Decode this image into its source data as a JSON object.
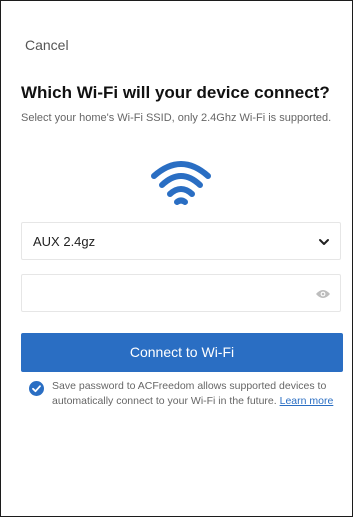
{
  "header": {
    "cancel_label": "Cancel"
  },
  "main": {
    "title": "Which Wi-Fi will your device connect?",
    "subtitle": "Select your home's Wi-Fi SSID,  only 2.4Ghz Wi-Fi is supported.",
    "wifi_icon": "wifi-icon",
    "ssid_value": "AUX 2.4gz",
    "password_value": "",
    "password_placeholder": "",
    "connect_label": "Connect to Wi-Fi",
    "save_note_text": "Save password to ACFreedom allows supported devices to automatically connect to your Wi-Fi in the future. ",
    "learn_more_label": "Learn more",
    "save_password_checked": true
  },
  "colors": {
    "accent": "#2a6ec3",
    "text_primary": "#111111",
    "text_secondary": "#666666",
    "border": "#e6e6e6"
  }
}
